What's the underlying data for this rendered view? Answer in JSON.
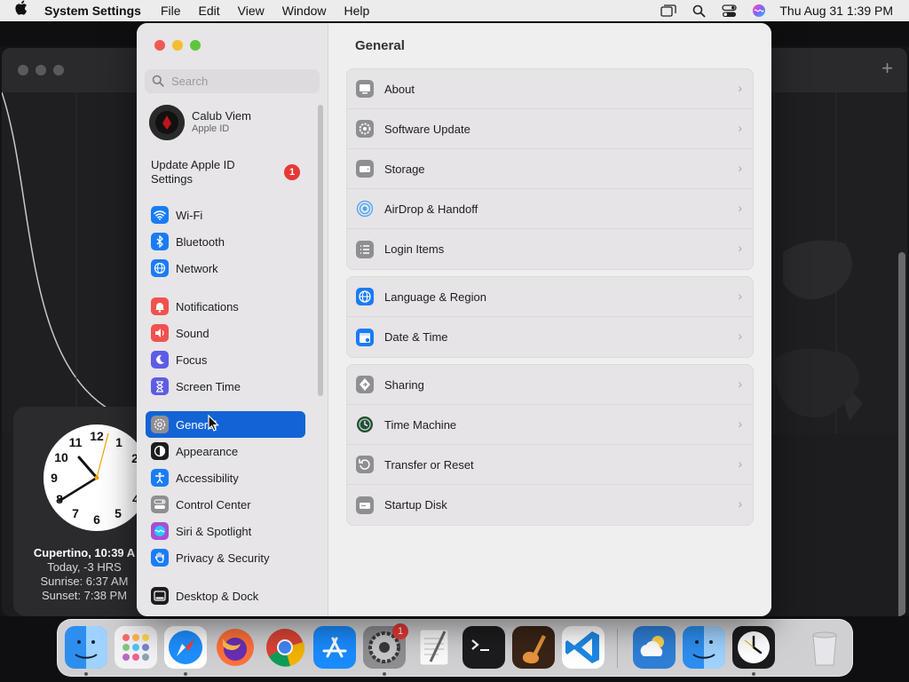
{
  "menubar": {
    "app_name": "System Settings",
    "menus": [
      "File",
      "Edit",
      "View",
      "Window",
      "Help"
    ],
    "datetime": "Thu Aug 31  1:39 PM",
    "status_icons": [
      "window-icon",
      "search-icon",
      "control-center-icon",
      "siri-icon"
    ]
  },
  "sidebar": {
    "search_placeholder": "Search",
    "user": {
      "name": "Calub Viem",
      "subtitle": "Apple ID"
    },
    "update": {
      "label": "Update Apple ID Settings",
      "badge": "1"
    },
    "items": [
      {
        "label": "Wi-Fi",
        "icon": "wifi-icon",
        "color": "#1a7cf5"
      },
      {
        "label": "Bluetooth",
        "icon": "bluetooth-icon",
        "color": "#1a7cf5"
      },
      {
        "label": "Network",
        "icon": "globe-icon",
        "color": "#1a7cf5"
      },
      {
        "label": "Notifications",
        "icon": "bell-icon",
        "color": "#f0524e"
      },
      {
        "label": "Sound",
        "icon": "speaker-icon",
        "color": "#f0524e"
      },
      {
        "label": "Focus",
        "icon": "moon-icon",
        "color": "#5e5ce6"
      },
      {
        "label": "Screen Time",
        "icon": "hourglass-icon",
        "color": "#5e5ce6"
      },
      {
        "label": "General",
        "icon": "gear-icon",
        "color": "#8e8e93",
        "selected": true
      },
      {
        "label": "Appearance",
        "icon": "appearance-icon",
        "color": "#1d1d1f"
      },
      {
        "label": "Accessibility",
        "icon": "accessibility-icon",
        "color": "#1a7cf5"
      },
      {
        "label": "Control Center",
        "icon": "control-center-icon",
        "color": "#8e8e93"
      },
      {
        "label": "Siri & Spotlight",
        "icon": "siri-icon",
        "color": "#a64fd6"
      },
      {
        "label": "Privacy & Security",
        "icon": "hand-icon",
        "color": "#1a7cf5"
      },
      {
        "label": "Desktop & Dock",
        "icon": "dock-icon",
        "color": "#1d1d1f"
      }
    ]
  },
  "content": {
    "title": "General",
    "groups": [
      [
        {
          "label": "About",
          "icon": "display-icon"
        },
        {
          "label": "Software Update",
          "icon": "gear-badge-icon"
        },
        {
          "label": "Storage",
          "icon": "disk-icon"
        },
        {
          "label": "AirDrop & Handoff",
          "icon": "airdrop-icon"
        },
        {
          "label": "Login Items",
          "icon": "list-icon"
        }
      ],
      [
        {
          "label": "Language & Region",
          "icon": "globe-icon"
        },
        {
          "label": "Date & Time",
          "icon": "calendar-icon"
        }
      ],
      [
        {
          "label": "Sharing",
          "icon": "sharing-icon"
        },
        {
          "label": "Time Machine",
          "icon": "time-machine-icon"
        },
        {
          "label": "Transfer or Reset",
          "icon": "reset-icon"
        },
        {
          "label": "Startup Disk",
          "icon": "startup-disk-icon"
        }
      ]
    ]
  },
  "clock_widget": {
    "city_line": "Cupertino, 10:39 A",
    "offset_line": "Today, -3 HRS",
    "sunrise": "Sunrise: 6:37 AM",
    "sunset": "Sunset: 7:38 PM",
    "numbers": [
      "12",
      "1",
      "2",
      "4",
      "5",
      "6",
      "7",
      "8",
      "9",
      "10",
      "11"
    ]
  },
  "dock": {
    "apps": [
      "finder-icon",
      "launchpad-icon",
      "safari-icon",
      "firefox-icon",
      "chrome-icon",
      "app-store-icon",
      "system-settings-icon",
      "textedit-icon",
      "terminal-icon",
      "garageband-icon",
      "vscode-icon",
      "weather-icon",
      "finder-alt-icon",
      "clock-icon",
      "trash-icon"
    ],
    "settings_badge": "1"
  }
}
